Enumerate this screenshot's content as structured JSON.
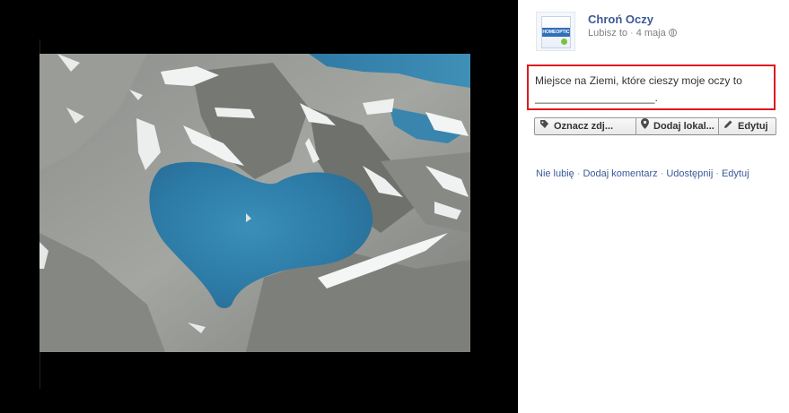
{
  "post": {
    "page_name": "Chroń Oczy",
    "like_label": "Lubisz to",
    "date": "4 maja",
    "avatar_text": "HOMEOPTIC",
    "caption": "Miejsce na Ziemi, które cieszy moje oczy to",
    "caption_blank": "____________________."
  },
  "actions": {
    "tag_label": "Oznacz zdj...",
    "location_label": "Dodaj lokal...",
    "edit_label": "Edytuj"
  },
  "links": {
    "unlike": "Nie lubię",
    "comment": "Dodaj komentarz",
    "share": "Udostępnij",
    "edit": "Edytuj"
  },
  "colors": {
    "link": "#3b5998",
    "highlight_border": "#e0191f",
    "lightbox_background": "#000000"
  },
  "icons": [
    "tag-icon",
    "location-pin-icon",
    "pencil-icon",
    "globe-icon"
  ]
}
